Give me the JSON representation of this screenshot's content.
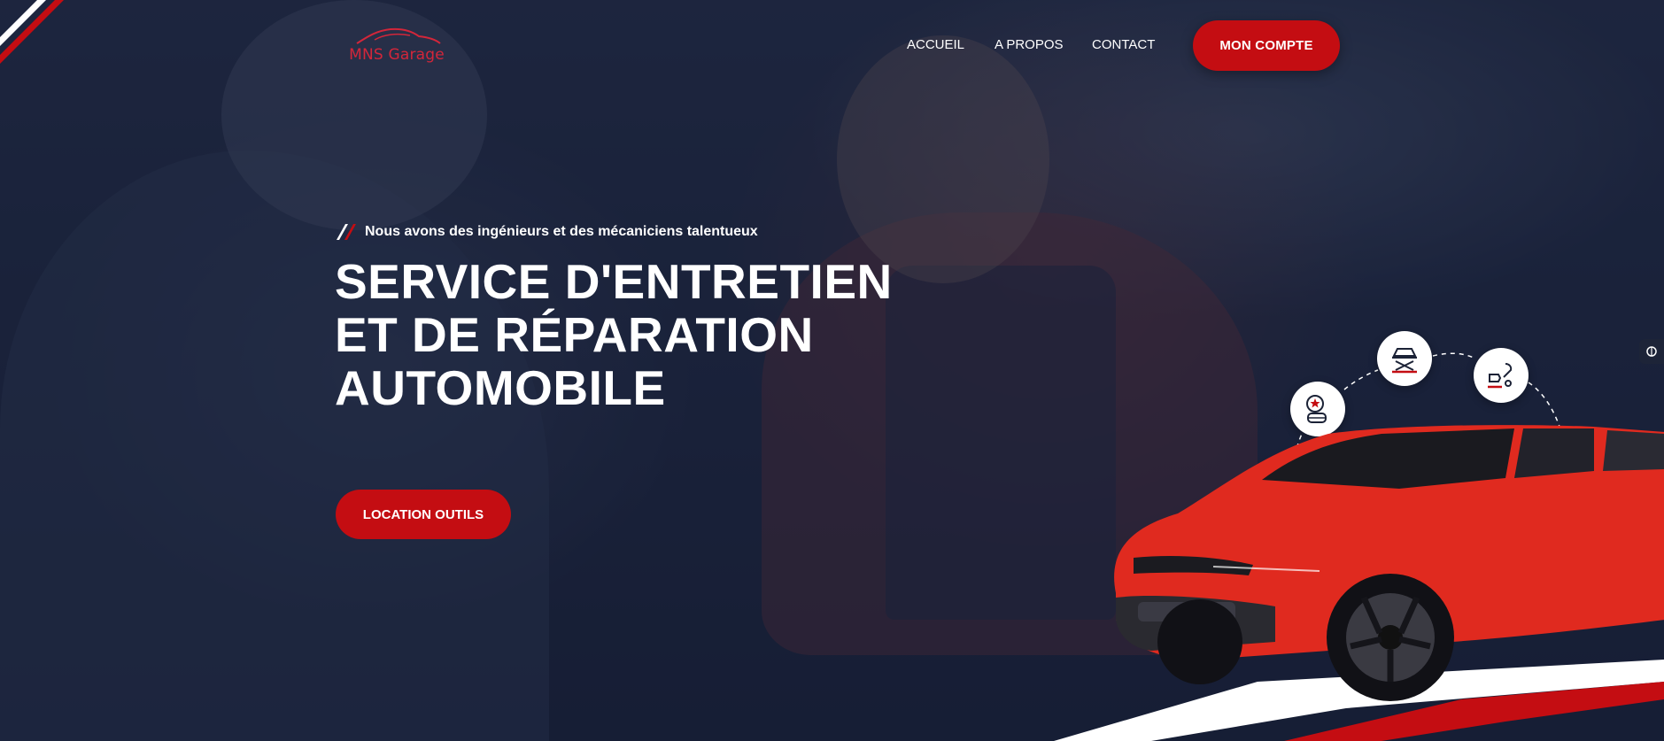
{
  "brand": {
    "name": "MNS Garage",
    "color": "#d3263a"
  },
  "nav": {
    "items": [
      "ACCUEIL",
      "A PROPOS",
      "CONTACT"
    ],
    "account_button": "MON COMPTE"
  },
  "hero": {
    "tagline": "Nous avons des ingénieurs et des mécaniciens talentueux",
    "title": "SERVICE D'ENTRETIEN ET DE RÉPARATION AUTOMOBILE",
    "cta": "LOCATION OUTILS"
  },
  "services": [
    {
      "icon": "tire-service-icon"
    },
    {
      "icon": "car-lift-icon"
    },
    {
      "icon": "repair-tools-icon"
    }
  ],
  "colors": {
    "accent": "#c40d12",
    "background": "#1b2236",
    "text": "#ffffff"
  }
}
